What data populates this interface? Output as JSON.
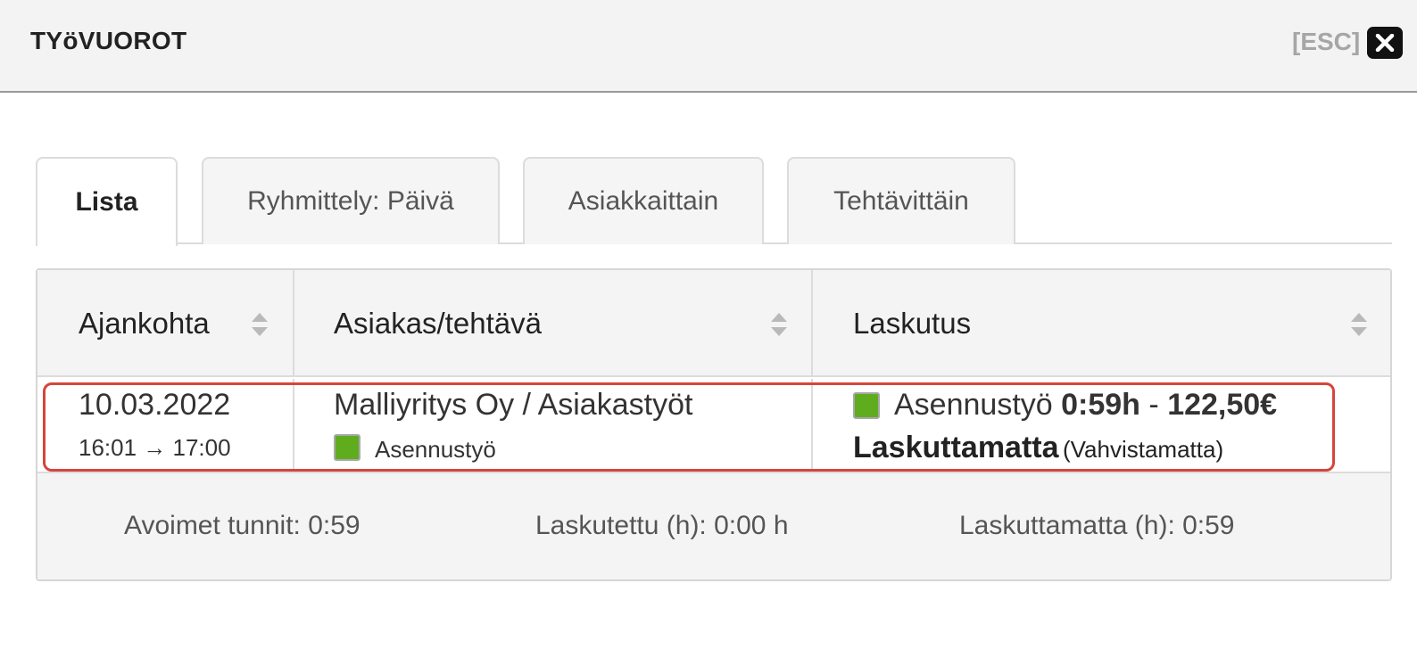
{
  "header": {
    "title": "TYöVUOROT",
    "esc_label": "[ESC]"
  },
  "tabs": [
    {
      "label": "Lista",
      "active": true
    },
    {
      "label": "Ryhmittely: Päivä",
      "active": false
    },
    {
      "label": "Asiakkaittain",
      "active": false
    },
    {
      "label": "Tehtävittäin",
      "active": false
    }
  ],
  "table": {
    "columns": [
      "Ajankohta",
      "Asiakas/tehtävä",
      "Laskutus"
    ],
    "rows": [
      {
        "date": "10.03.2022",
        "time": "16:01 → 17:00",
        "customer_task": "Malliyritys Oy / Asiakastyöt",
        "task_type": "Asennustyö",
        "billing_type": "Asennustyö",
        "billing_duration": "0:59h",
        "billing_separator": "-",
        "billing_amount": "122,50€",
        "billing_status": "Laskuttamatta",
        "billing_confirmation": "(Vahvistamatta)",
        "task_color": "#5fad1e"
      }
    ]
  },
  "footer": {
    "open_hours": "Avoimet tunnit: 0:59",
    "billed_hours": "Laskutettu (h): 0:00 h",
    "unbilled_hours": "Laskuttamatta (h): 0:59"
  },
  "icons": {
    "close": "close-icon",
    "sort": "sort-icon"
  },
  "colors": {
    "highlight": "#d6453c",
    "task": "#5fad1e"
  }
}
